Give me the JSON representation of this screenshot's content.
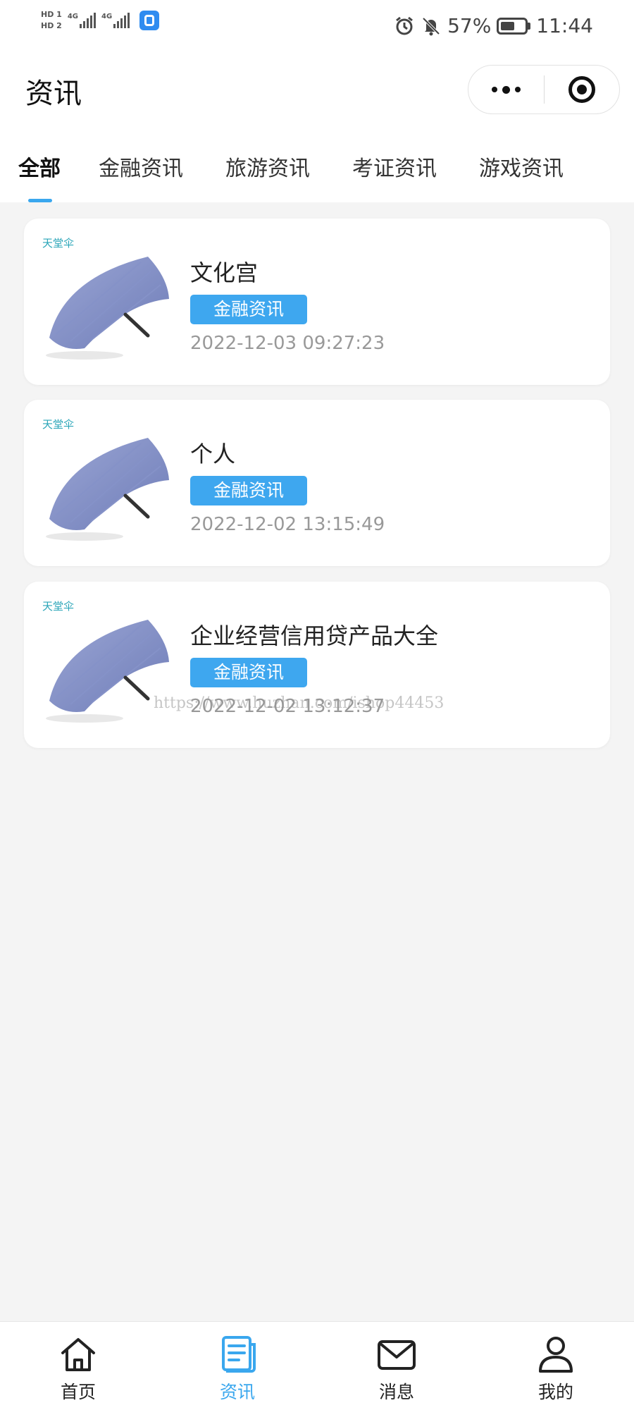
{
  "status_bar": {
    "sim1_badge": "HD 1",
    "sim2_badge": "HD 2",
    "net1": "4G",
    "net2": "4G",
    "battery_percent": "57%",
    "battery_level": 0.57,
    "time": "11:44"
  },
  "header": {
    "title": "资讯"
  },
  "tabs": [
    {
      "label": "全部",
      "active": true
    },
    {
      "label": "金融资讯",
      "active": false
    },
    {
      "label": "旅游资讯",
      "active": false
    },
    {
      "label": "考证资讯",
      "active": false
    },
    {
      "label": "游戏资讯",
      "active": false
    }
  ],
  "articles": [
    {
      "title": "文化宫",
      "tag": "金融资讯",
      "date": "2022-12-03 09:27:23",
      "thumb_brand": "天堂伞"
    },
    {
      "title": "个人",
      "tag": "金融资讯",
      "date": "2022-12-02 13:15:49",
      "thumb_brand": "天堂伞"
    },
    {
      "title": "企业经营信用贷产品大全",
      "tag": "金融资讯",
      "date": "2022-12-02 13:12:37",
      "thumb_brand": "天堂伞"
    }
  ],
  "watermark": "https://www.huzhan.com/ishop44453",
  "bottom_nav": [
    {
      "label": "首页",
      "icon": "home-icon",
      "active": false
    },
    {
      "label": "资讯",
      "icon": "news-icon",
      "active": true
    },
    {
      "label": "消息",
      "icon": "mail-icon",
      "active": false
    },
    {
      "label": "我的",
      "icon": "user-icon",
      "active": false
    }
  ],
  "colors": {
    "accent": "#3aa7ee",
    "tag_bg": "#3ea7ef",
    "page_bg": "#f4f4f4",
    "date_text": "#999999"
  }
}
